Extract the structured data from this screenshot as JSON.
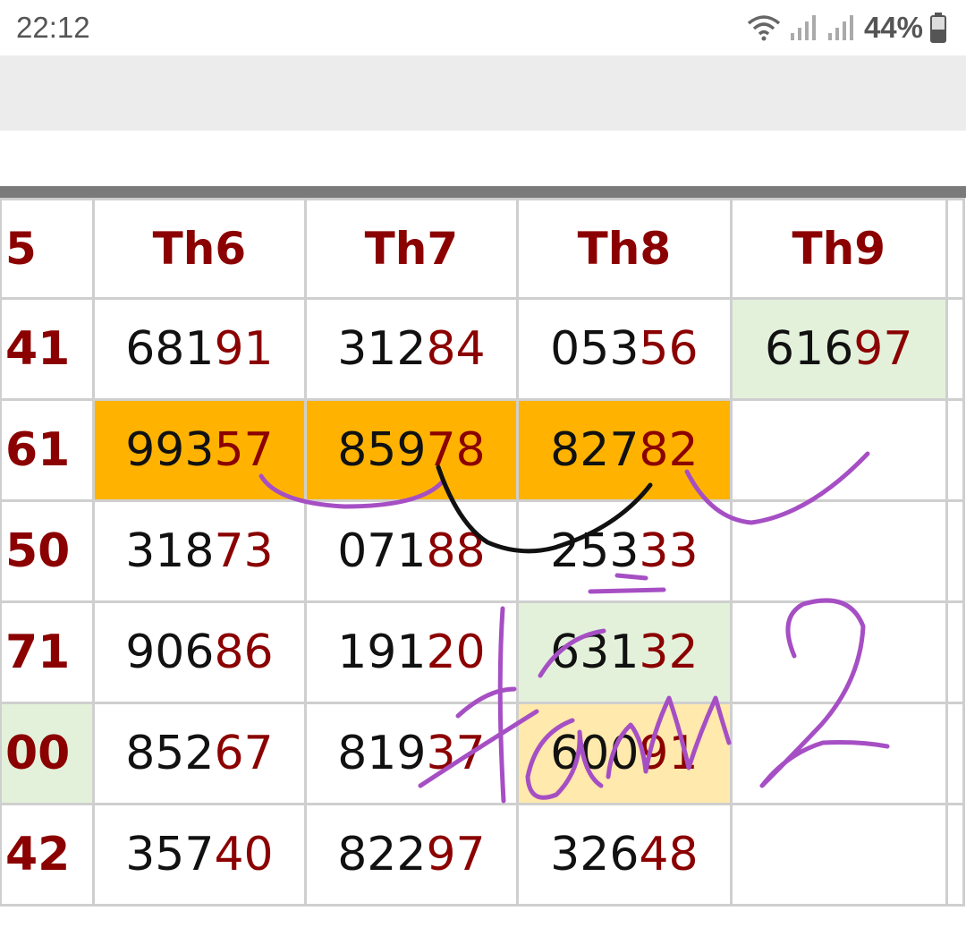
{
  "status_bar": {
    "time": "22:12",
    "battery": "44%",
    "icons": [
      "wifi-icon",
      "signal-icon",
      "signal-icon",
      "battery-icon"
    ]
  },
  "table": {
    "headers": [
      "5",
      "Th6",
      "Th7",
      "Th8",
      "Th9"
    ],
    "rows": [
      [
        {
          "head": "",
          "tail": "41"
        },
        {
          "head": "681",
          "tail": "91"
        },
        {
          "head": "312",
          "tail": "84"
        },
        {
          "head": "053",
          "tail": "56"
        },
        {
          "head": "616",
          "tail": "97",
          "bg": "green"
        }
      ],
      [
        {
          "head": "",
          "tail": "61"
        },
        {
          "head": "993",
          "tail": "57",
          "bg": "orange"
        },
        {
          "head": "859",
          "tail": "78",
          "bg": "orange"
        },
        {
          "head": "827",
          "tail": "82",
          "bg": "orange"
        },
        {
          "head": "",
          "tail": ""
        }
      ],
      [
        {
          "head": "",
          "tail": "50"
        },
        {
          "head": "318",
          "tail": "73"
        },
        {
          "head": "071",
          "tail": "88"
        },
        {
          "head": "253",
          "tail": "33"
        },
        {
          "head": "",
          "tail": ""
        }
      ],
      [
        {
          "head": "",
          "tail": "71"
        },
        {
          "head": "906",
          "tail": "86"
        },
        {
          "head": "191",
          "tail": "20"
        },
        {
          "head": "631",
          "tail": "32",
          "bg": "green"
        },
        {
          "head": "",
          "tail": ""
        }
      ],
      [
        {
          "head": "",
          "tail": "00",
          "bg": "green"
        },
        {
          "head": "852",
          "tail": "67"
        },
        {
          "head": "819",
          "tail": "37"
        },
        {
          "head": "600",
          "tail": "91",
          "bg": "yellow"
        },
        {
          "head": "",
          "tail": ""
        }
      ],
      [
        {
          "head": "",
          "tail": "42"
        },
        {
          "head": "357",
          "tail": "40"
        },
        {
          "head": "822",
          "tail": "97"
        },
        {
          "head": "326",
          "tail": "48"
        },
        {
          "head": "",
          "tail": ""
        }
      ]
    ]
  },
  "colors": {
    "accent_red": "#8b0000",
    "highlight_orange": "#ffb300",
    "highlight_green": "#e3f1db",
    "highlight_yellow": "#ffe9ad",
    "ink_purple": "#a64fc4",
    "ink_black": "#111111"
  }
}
